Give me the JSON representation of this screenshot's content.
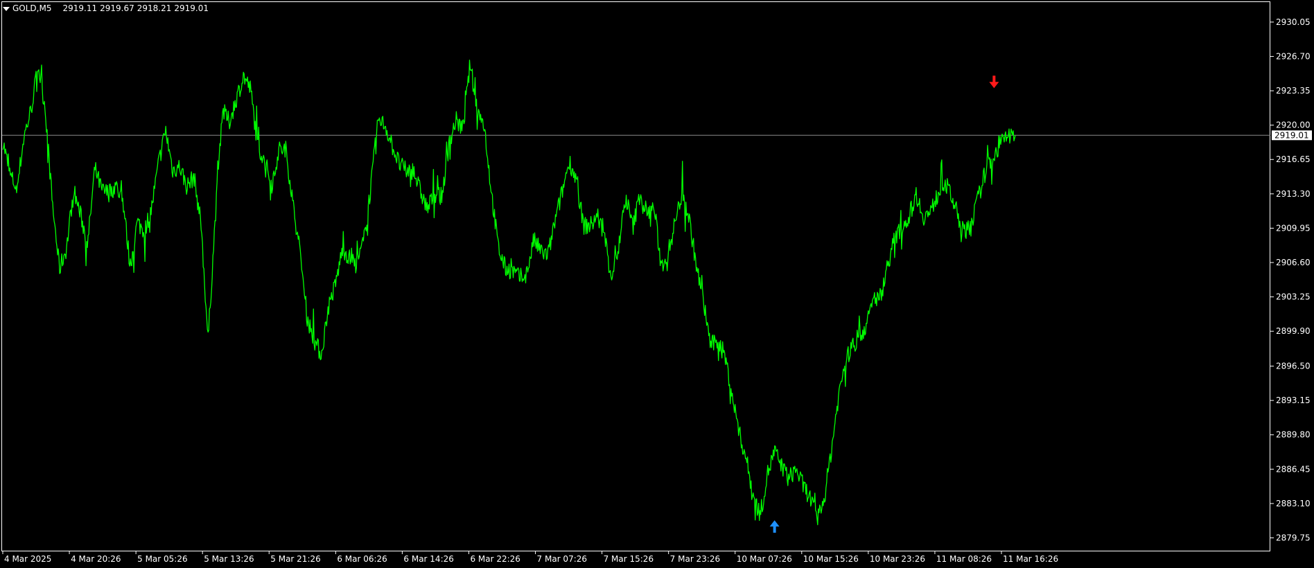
{
  "header": {
    "symbol": "GOLD,M5",
    "open": "2919.11",
    "high": "2919.67",
    "low": "2918.21",
    "close": "2919.01"
  },
  "colors": {
    "background": "#000000",
    "price_line": "#00ff00",
    "axis": "#ffffff",
    "bid_line": "#8c8c8c",
    "buy_arrow": "#1e90ff",
    "sell_arrow": "#ff1a1a",
    "price_label_bg": "#ffffff",
    "price_label_text": "#000000"
  },
  "icons": {
    "menu": "triangle-down-icon",
    "buy_signal": "arrow-up-icon",
    "sell_signal": "arrow-down-icon"
  },
  "chart_data": {
    "type": "line",
    "timeframe": "M5",
    "ylim": [
      2878.5,
      2932.0
    ],
    "yticks": [
      "2930.05",
      "2926.70",
      "2923.35",
      "2920.00",
      "2916.65",
      "2913.30",
      "2909.95",
      "2906.60",
      "2903.25",
      "2899.90",
      "2896.50",
      "2893.15",
      "2889.80",
      "2886.45",
      "2883.10",
      "2879.75"
    ],
    "xticks": [
      "4 Mar 2025",
      "4 Mar 20:26",
      "5 Mar 05:26",
      "5 Mar 13:26",
      "5 Mar 21:26",
      "6 Mar 06:26",
      "6 Mar 14:26",
      "6 Mar 22:26",
      "7 Mar 07:26",
      "7 Mar 15:26",
      "7 Mar 23:26",
      "10 Mar 07:26",
      "10 Mar 15:26",
      "10 Mar 23:26",
      "11 Mar 08:26",
      "11 Mar 16:26"
    ],
    "current_price": "2919.01",
    "series": [
      {
        "values": [
          2918.5,
          2915.2,
          2913.8,
          2918.9,
          2921.5,
          2925.8,
          2921.7,
          2912.4,
          2906.0,
          2908.0,
          2913.7,
          2911.2,
          2908.4,
          2915.8,
          2913.6,
          2913.4,
          2914.1,
          2912.5,
          2906.2,
          2910.5,
          2909.7,
          2911.8,
          2916.3,
          2919.5,
          2915.6,
          2916.0,
          2914.0,
          2915.0,
          2910.4,
          2899.0,
          2910.8,
          2921.5,
          2920.3,
          2922.6,
          2924.8,
          2923.5,
          2918.0,
          2916.5,
          2914.2,
          2917.6,
          2917.6,
          2912.2,
          2907.5,
          2901.2,
          2899.0,
          2897.6,
          2902.3,
          2904.5,
          2908.0,
          2907.0,
          2906.3,
          2908.8,
          2914.1,
          2920.5,
          2920.0,
          2918.0,
          2916.2,
          2915.5,
          2915.6,
          2913.5,
          2911.8,
          2913.4,
          2913.0,
          2918.0,
          2920.5,
          2919.6,
          2926.0,
          2921.5,
          2920.0,
          2913.5,
          2908.0,
          2906.0,
          2905.8,
          2905.1,
          2905.5,
          2908.8,
          2907.7,
          2907.3,
          2910.6,
          2913.5,
          2916.5,
          2914.7,
          2910.2,
          2910.2,
          2911.2,
          2909.1,
          2905.3,
          2908.1,
          2913.0,
          2910.0,
          2913.4,
          2911.4,
          2912.0,
          2906.2,
          2907.6,
          2910.7,
          2913.6,
          2910.6,
          2906.1,
          2902.6,
          2898.5,
          2899.0,
          2897.5,
          2893.7,
          2890.0,
          2887.5,
          2883.8,
          2882.0,
          2886.0,
          2888.2,
          2886.7,
          2885.5,
          2886.5,
          2884.9,
          2883.7,
          2881.5,
          2883.5,
          2888.2,
          2893.4,
          2897.0,
          2898.4,
          2899.4,
          2900.5,
          2903.1,
          2903.3,
          2906.5,
          2909.0,
          2910.0,
          2911.1,
          2913.3,
          2911.1,
          2911.4,
          2913.2,
          2914.5,
          2913.0,
          2911.0,
          2909.2,
          2911.0,
          2913.5,
          2916.0,
          2917.0,
          2918.3,
          2919.0,
          2919.01
        ],
        "noise": 0.9
      }
    ],
    "signals": [
      {
        "type": "buy",
        "index": 109,
        "price": 2882.0
      },
      {
        "type": "sell",
        "index": 140,
        "price": 2922.8
      }
    ]
  }
}
